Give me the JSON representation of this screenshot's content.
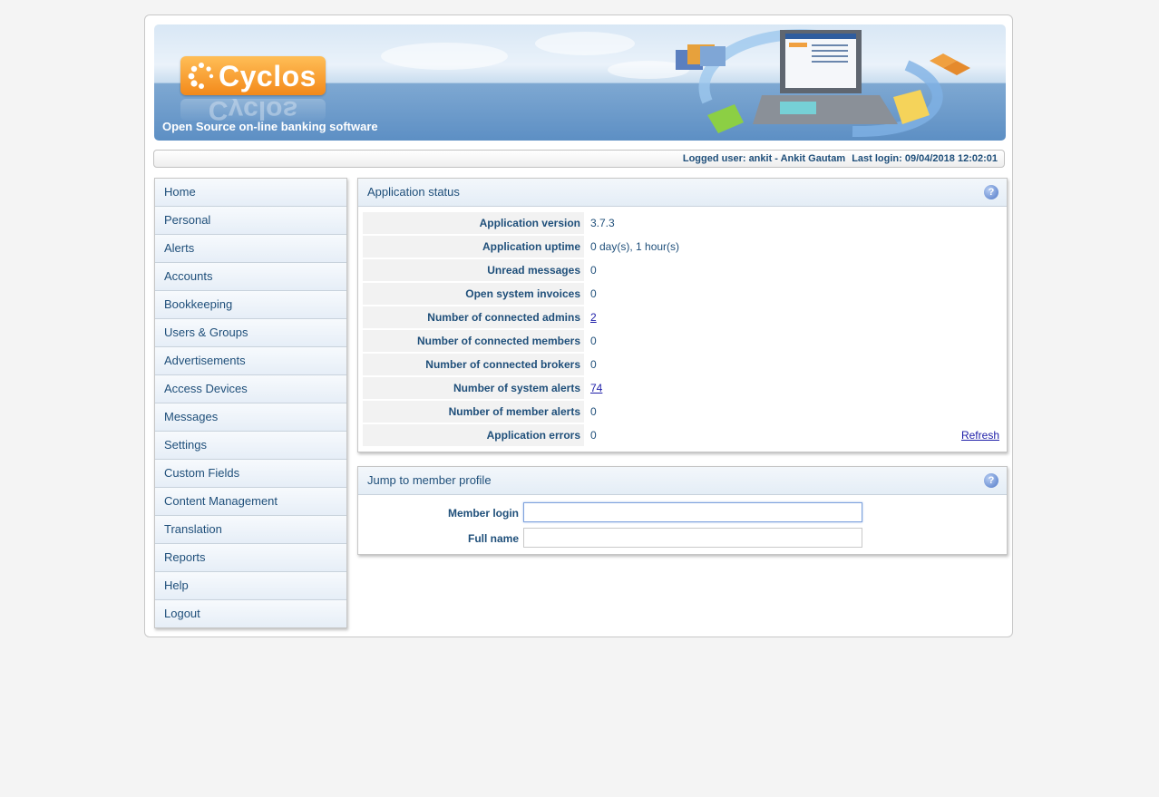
{
  "banner": {
    "logo_text": "Cyclos",
    "tagline": "Open Source on-line banking software"
  },
  "userbar": {
    "logged_user": "Logged user: ankit - Ankit Gautam",
    "last_login": "Last login: 09/04/2018 12:02:01"
  },
  "menu": {
    "items": [
      "Home",
      "Personal",
      "Alerts",
      "Accounts",
      "Bookkeeping",
      "Users & Groups",
      "Advertisements",
      "Access Devices",
      "Messages",
      "Settings",
      "Custom Fields",
      "Content Management",
      "Translation",
      "Reports",
      "Help",
      "Logout"
    ]
  },
  "status": {
    "title": "Application status",
    "help_icon": "help-icon",
    "rows": [
      {
        "label": "Application version",
        "value": "3.7.3"
      },
      {
        "label": "Application uptime",
        "value": "0 day(s), 1 hour(s)"
      },
      {
        "label": "Unread messages",
        "value": "0"
      },
      {
        "label": "Open system invoices",
        "value": "0"
      },
      {
        "label": "Number of connected admins",
        "value": "2"
      },
      {
        "label": "Number of connected members",
        "value": "0"
      },
      {
        "label": "Number of connected brokers",
        "value": "0"
      },
      {
        "label": "Number of system alerts",
        "value": "74"
      },
      {
        "label": "Number of member alerts",
        "value": "0"
      },
      {
        "label": "Application errors",
        "value": "0"
      }
    ],
    "refresh_label": "Refresh"
  },
  "jump": {
    "title": "Jump to member profile",
    "member_login_label": "Member login",
    "member_login_value": "",
    "full_name_label": "Full name",
    "full_name_value": ""
  },
  "colors": {
    "text": "#1f4f7a",
    "link": "#1d1da8",
    "logo_orange": "#f3891a",
    "background": "#f4f4f4"
  }
}
